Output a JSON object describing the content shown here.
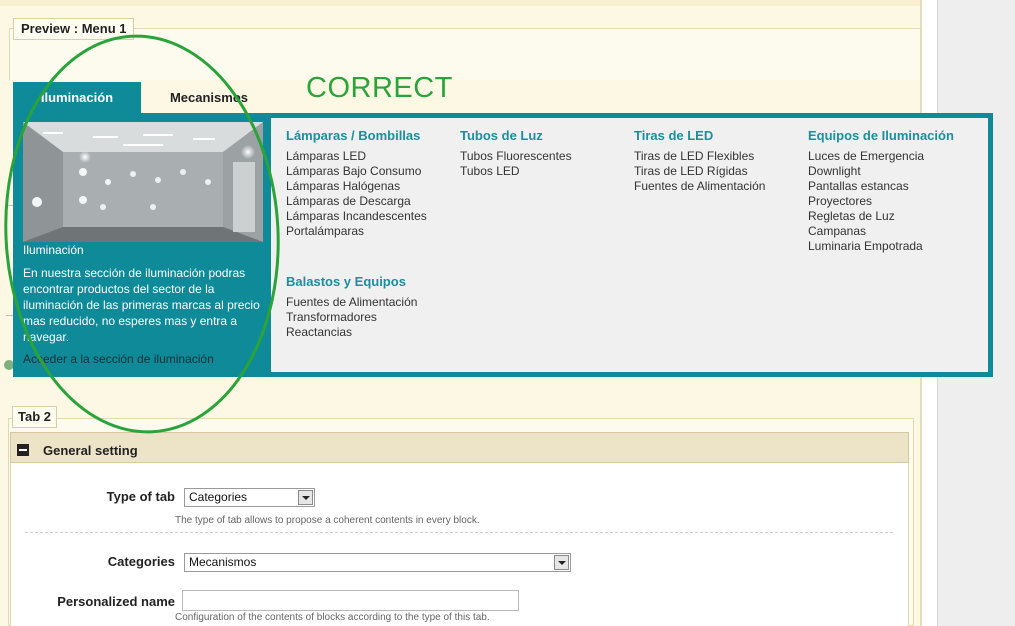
{
  "preview": {
    "legend": "Preview : Menu 1"
  },
  "tabs": [
    {
      "label": "Iluminación",
      "active": true
    },
    {
      "label": "Mecanismos",
      "active": false
    }
  ],
  "annotation": {
    "text": "CORRECT",
    "color": "#2aa33a"
  },
  "menu": {
    "accent_color": "#0e8a99",
    "feature": {
      "caption": "Iluminación",
      "description": "En nuestra sección de iluminación podras encontrar productos del sector de la iluminación de las primeras marcas al precio mas reducido, no esperes mas y entra a navegar.",
      "link": "Acceder a la sección de iluminación"
    },
    "columns": [
      {
        "title": "Lámparas / Bombillas",
        "items": [
          "Lámparas LED",
          "Lámparas Bajo Consumo",
          "Lámparas Halógenas",
          "Lámparas de Descarga",
          "Lámparas Incandescentes",
          "Portalámparas"
        ]
      },
      {
        "title": "Tubos de Luz",
        "items": [
          "Tubos Fluorescentes",
          "Tubos LED"
        ]
      },
      {
        "title": "Tiras de LED",
        "items": [
          "Tiras de LED Flexibles",
          "Tiras de LED Rígidas",
          "Fuentes de Alimentación"
        ]
      },
      {
        "title": "Equipos de Iluminación",
        "items": [
          "Luces de Emergencia",
          "Downlight",
          "Pantallas estancas",
          "Proyectores",
          "Regletas de Luz",
          "Campanas",
          "Luminaria Empotrada"
        ]
      },
      {
        "title": "Balastos y Equipos",
        "items": [
          "Fuentes de Alimentación",
          "Transformadores",
          "Reactancias"
        ]
      }
    ]
  },
  "tab2": {
    "legend": "Tab 2",
    "section_title": "General setting",
    "type_of_tab": {
      "label": "Type of tab",
      "value": "Categories",
      "hint": "The type of tab allows to propose a coherent contents in every block."
    },
    "categories": {
      "label": "Categories",
      "value": "Mecanismos"
    },
    "personalized_name": {
      "label": "Personalized name",
      "value": "",
      "hint": "Configuration of the contents of blocks according to the type of this tab."
    }
  }
}
